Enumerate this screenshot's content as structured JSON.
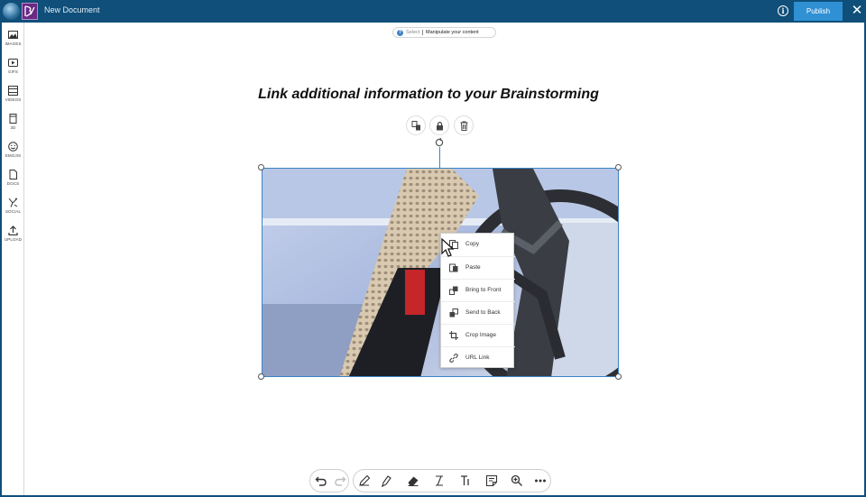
{
  "titlebar": {
    "document_title": "New Document",
    "publish_label": "Publish",
    "bg_color": "#0f4f79",
    "accent_color": "#2f90d4"
  },
  "sidebar": {
    "items": [
      {
        "label": "IMAGES",
        "icon": "image-icon"
      },
      {
        "label": "GIFS",
        "icon": "gif-icon"
      },
      {
        "label": "VIDEOS",
        "icon": "video-icon"
      },
      {
        "label": "3D",
        "icon": "cube-icon"
      },
      {
        "label": "EMOJIS",
        "icon": "emoji-icon"
      },
      {
        "label": "DOCS",
        "icon": "document-icon"
      },
      {
        "label": "SOCIAL",
        "icon": "social-icon"
      },
      {
        "label": "UPLOAD",
        "icon": "upload-icon"
      }
    ]
  },
  "hint": {
    "mode": "Select",
    "message": "Manipulate your content"
  },
  "canvas": {
    "heading": "Link additional information to your Brainstorming"
  },
  "image_toolbar": {
    "buttons": [
      "duplicate-icon",
      "lock-icon",
      "trash-icon"
    ]
  },
  "context_menu": {
    "items": [
      {
        "label": "Copy",
        "icon": "copy-icon"
      },
      {
        "label": "Paste",
        "icon": "paste-icon"
      },
      {
        "label": "Bring to Front",
        "icon": "bring-front-icon"
      },
      {
        "label": "Send to Back",
        "icon": "send-back-icon"
      },
      {
        "label": "Crop Image",
        "icon": "crop-icon"
      },
      {
        "label": "URL Link",
        "icon": "link-icon"
      }
    ]
  },
  "bottom_toolbar": {
    "history": [
      "undo-icon",
      "redo-icon"
    ],
    "tools": [
      "pen-icon",
      "marker-icon",
      "eraser-icon",
      "text-cursor-icon",
      "text-icon",
      "sticky-note-icon",
      "zoom-icon",
      "more-icon"
    ]
  }
}
